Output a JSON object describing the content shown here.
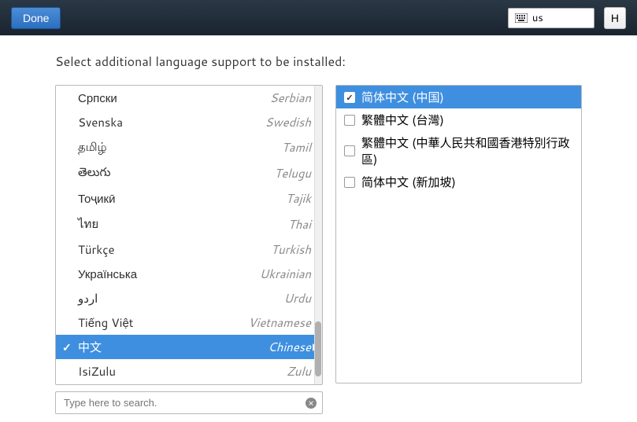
{
  "topbar": {
    "done_label": "Done",
    "keyboard_layout": "us",
    "right_button": "H"
  },
  "instructions": "Select additional language support to be installed:",
  "search": {
    "placeholder": "Type here to search."
  },
  "lang_list": {
    "items": [
      {
        "native": "Српски",
        "english": "Serbian",
        "selected": false
      },
      {
        "native": "Svenska",
        "english": "Swedish",
        "selected": false
      },
      {
        "native": "தமிழ்",
        "english": "Tamil",
        "selected": false
      },
      {
        "native": "తెలుగు",
        "english": "Telugu",
        "selected": false
      },
      {
        "native": "Тоҷикӣ",
        "english": "Tajik",
        "selected": false
      },
      {
        "native": "ไทย",
        "english": "Thai",
        "selected": false
      },
      {
        "native": "Türkçe",
        "english": "Turkish",
        "selected": false
      },
      {
        "native": "Українська",
        "english": "Ukrainian",
        "selected": false
      },
      {
        "native": "اردو",
        "english": "Urdu",
        "selected": false
      },
      {
        "native": "Tiếng Việt",
        "english": "Vietnamese",
        "selected": false
      },
      {
        "native": "中文",
        "english": "Chinese",
        "selected": true
      },
      {
        "native": "IsiZulu",
        "english": "Zulu",
        "selected": false
      }
    ]
  },
  "locale_list": {
    "items": [
      {
        "label": "简体中文 (中国)",
        "checked": true,
        "selected": true
      },
      {
        "label": "繁體中文 (台灣)",
        "checked": false,
        "selected": false
      },
      {
        "label": "繁體中文 (中華人民共和國香港特別行政區)",
        "checked": false,
        "selected": false
      },
      {
        "label": "简体中文 (新加坡)",
        "checked": false,
        "selected": false
      }
    ]
  }
}
